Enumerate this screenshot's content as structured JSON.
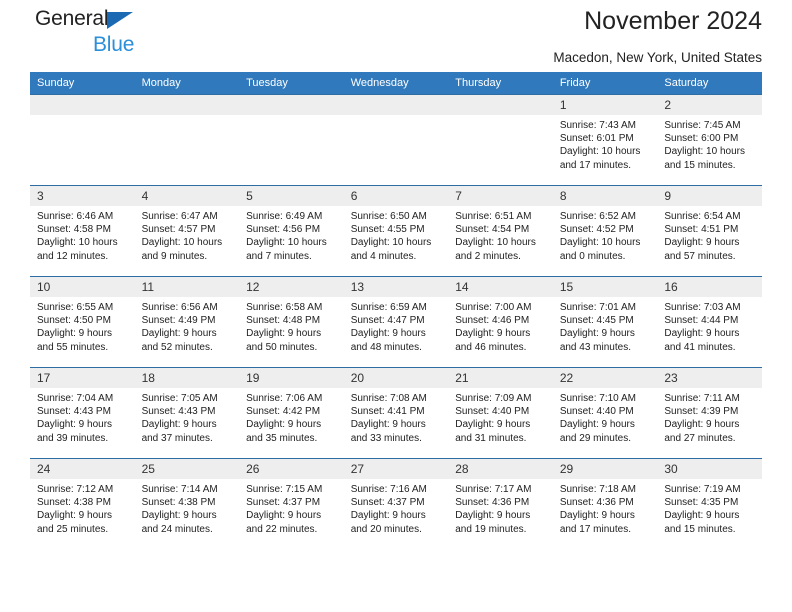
{
  "brand": {
    "name_top": "General",
    "name_bottom": "Blue",
    "triangle_color": "#1b69b3",
    "blue_color": "#2b8fd9"
  },
  "header": {
    "title": "November 2024",
    "location": "Macedon, New York, United States"
  },
  "theme": {
    "header_bg": "#3079bd",
    "header_text": "#ffffff",
    "daynum_bg": "#eeeeee",
    "row_border": "#2e6da4"
  },
  "weekdays": [
    "Sunday",
    "Monday",
    "Tuesday",
    "Wednesday",
    "Thursday",
    "Friday",
    "Saturday"
  ],
  "weeks": [
    [
      {
        "day": "",
        "sunrise": "",
        "sunset": "",
        "daylight_line1": "",
        "daylight_line2": "",
        "blank": true
      },
      {
        "day": "",
        "sunrise": "",
        "sunset": "",
        "daylight_line1": "",
        "daylight_line2": "",
        "blank": true
      },
      {
        "day": "",
        "sunrise": "",
        "sunset": "",
        "daylight_line1": "",
        "daylight_line2": "",
        "blank": true
      },
      {
        "day": "",
        "sunrise": "",
        "sunset": "",
        "daylight_line1": "",
        "daylight_line2": "",
        "blank": true
      },
      {
        "day": "",
        "sunrise": "",
        "sunset": "",
        "daylight_line1": "",
        "daylight_line2": "",
        "blank": true
      },
      {
        "day": "1",
        "sunrise": "Sunrise: 7:43 AM",
        "sunset": "Sunset: 6:01 PM",
        "daylight_line1": "Daylight: 10 hours",
        "daylight_line2": "and 17 minutes.",
        "blank": false
      },
      {
        "day": "2",
        "sunrise": "Sunrise: 7:45 AM",
        "sunset": "Sunset: 6:00 PM",
        "daylight_line1": "Daylight: 10 hours",
        "daylight_line2": "and 15 minutes.",
        "blank": false
      }
    ],
    [
      {
        "day": "3",
        "sunrise": "Sunrise: 6:46 AM",
        "sunset": "Sunset: 4:58 PM",
        "daylight_line1": "Daylight: 10 hours",
        "daylight_line2": "and 12 minutes.",
        "blank": false
      },
      {
        "day": "4",
        "sunrise": "Sunrise: 6:47 AM",
        "sunset": "Sunset: 4:57 PM",
        "daylight_line1": "Daylight: 10 hours",
        "daylight_line2": "and 9 minutes.",
        "blank": false
      },
      {
        "day": "5",
        "sunrise": "Sunrise: 6:49 AM",
        "sunset": "Sunset: 4:56 PM",
        "daylight_line1": "Daylight: 10 hours",
        "daylight_line2": "and 7 minutes.",
        "blank": false
      },
      {
        "day": "6",
        "sunrise": "Sunrise: 6:50 AM",
        "sunset": "Sunset: 4:55 PM",
        "daylight_line1": "Daylight: 10 hours",
        "daylight_line2": "and 4 minutes.",
        "blank": false
      },
      {
        "day": "7",
        "sunrise": "Sunrise: 6:51 AM",
        "sunset": "Sunset: 4:54 PM",
        "daylight_line1": "Daylight: 10 hours",
        "daylight_line2": "and 2 minutes.",
        "blank": false
      },
      {
        "day": "8",
        "sunrise": "Sunrise: 6:52 AM",
        "sunset": "Sunset: 4:52 PM",
        "daylight_line1": "Daylight: 10 hours",
        "daylight_line2": "and 0 minutes.",
        "blank": false
      },
      {
        "day": "9",
        "sunrise": "Sunrise: 6:54 AM",
        "sunset": "Sunset: 4:51 PM",
        "daylight_line1": "Daylight: 9 hours",
        "daylight_line2": "and 57 minutes.",
        "blank": false
      }
    ],
    [
      {
        "day": "10",
        "sunrise": "Sunrise: 6:55 AM",
        "sunset": "Sunset: 4:50 PM",
        "daylight_line1": "Daylight: 9 hours",
        "daylight_line2": "and 55 minutes.",
        "blank": false
      },
      {
        "day": "11",
        "sunrise": "Sunrise: 6:56 AM",
        "sunset": "Sunset: 4:49 PM",
        "daylight_line1": "Daylight: 9 hours",
        "daylight_line2": "and 52 minutes.",
        "blank": false
      },
      {
        "day": "12",
        "sunrise": "Sunrise: 6:58 AM",
        "sunset": "Sunset: 4:48 PM",
        "daylight_line1": "Daylight: 9 hours",
        "daylight_line2": "and 50 minutes.",
        "blank": false
      },
      {
        "day": "13",
        "sunrise": "Sunrise: 6:59 AM",
        "sunset": "Sunset: 4:47 PM",
        "daylight_line1": "Daylight: 9 hours",
        "daylight_line2": "and 48 minutes.",
        "blank": false
      },
      {
        "day": "14",
        "sunrise": "Sunrise: 7:00 AM",
        "sunset": "Sunset: 4:46 PM",
        "daylight_line1": "Daylight: 9 hours",
        "daylight_line2": "and 46 minutes.",
        "blank": false
      },
      {
        "day": "15",
        "sunrise": "Sunrise: 7:01 AM",
        "sunset": "Sunset: 4:45 PM",
        "daylight_line1": "Daylight: 9 hours",
        "daylight_line2": "and 43 minutes.",
        "blank": false
      },
      {
        "day": "16",
        "sunrise": "Sunrise: 7:03 AM",
        "sunset": "Sunset: 4:44 PM",
        "daylight_line1": "Daylight: 9 hours",
        "daylight_line2": "and 41 minutes.",
        "blank": false
      }
    ],
    [
      {
        "day": "17",
        "sunrise": "Sunrise: 7:04 AM",
        "sunset": "Sunset: 4:43 PM",
        "daylight_line1": "Daylight: 9 hours",
        "daylight_line2": "and 39 minutes.",
        "blank": false
      },
      {
        "day": "18",
        "sunrise": "Sunrise: 7:05 AM",
        "sunset": "Sunset: 4:43 PM",
        "daylight_line1": "Daylight: 9 hours",
        "daylight_line2": "and 37 minutes.",
        "blank": false
      },
      {
        "day": "19",
        "sunrise": "Sunrise: 7:06 AM",
        "sunset": "Sunset: 4:42 PM",
        "daylight_line1": "Daylight: 9 hours",
        "daylight_line2": "and 35 minutes.",
        "blank": false
      },
      {
        "day": "20",
        "sunrise": "Sunrise: 7:08 AM",
        "sunset": "Sunset: 4:41 PM",
        "daylight_line1": "Daylight: 9 hours",
        "daylight_line2": "and 33 minutes.",
        "blank": false
      },
      {
        "day": "21",
        "sunrise": "Sunrise: 7:09 AM",
        "sunset": "Sunset: 4:40 PM",
        "daylight_line1": "Daylight: 9 hours",
        "daylight_line2": "and 31 minutes.",
        "blank": false
      },
      {
        "day": "22",
        "sunrise": "Sunrise: 7:10 AM",
        "sunset": "Sunset: 4:40 PM",
        "daylight_line1": "Daylight: 9 hours",
        "daylight_line2": "and 29 minutes.",
        "blank": false
      },
      {
        "day": "23",
        "sunrise": "Sunrise: 7:11 AM",
        "sunset": "Sunset: 4:39 PM",
        "daylight_line1": "Daylight: 9 hours",
        "daylight_line2": "and 27 minutes.",
        "blank": false
      }
    ],
    [
      {
        "day": "24",
        "sunrise": "Sunrise: 7:12 AM",
        "sunset": "Sunset: 4:38 PM",
        "daylight_line1": "Daylight: 9 hours",
        "daylight_line2": "and 25 minutes.",
        "blank": false
      },
      {
        "day": "25",
        "sunrise": "Sunrise: 7:14 AM",
        "sunset": "Sunset: 4:38 PM",
        "daylight_line1": "Daylight: 9 hours",
        "daylight_line2": "and 24 minutes.",
        "blank": false
      },
      {
        "day": "26",
        "sunrise": "Sunrise: 7:15 AM",
        "sunset": "Sunset: 4:37 PM",
        "daylight_line1": "Daylight: 9 hours",
        "daylight_line2": "and 22 minutes.",
        "blank": false
      },
      {
        "day": "27",
        "sunrise": "Sunrise: 7:16 AM",
        "sunset": "Sunset: 4:37 PM",
        "daylight_line1": "Daylight: 9 hours",
        "daylight_line2": "and 20 minutes.",
        "blank": false
      },
      {
        "day": "28",
        "sunrise": "Sunrise: 7:17 AM",
        "sunset": "Sunset: 4:36 PM",
        "daylight_line1": "Daylight: 9 hours",
        "daylight_line2": "and 19 minutes.",
        "blank": false
      },
      {
        "day": "29",
        "sunrise": "Sunrise: 7:18 AM",
        "sunset": "Sunset: 4:36 PM",
        "daylight_line1": "Daylight: 9 hours",
        "daylight_line2": "and 17 minutes.",
        "blank": false
      },
      {
        "day": "30",
        "sunrise": "Sunrise: 7:19 AM",
        "sunset": "Sunset: 4:35 PM",
        "daylight_line1": "Daylight: 9 hours",
        "daylight_line2": "and 15 minutes.",
        "blank": false
      }
    ]
  ]
}
